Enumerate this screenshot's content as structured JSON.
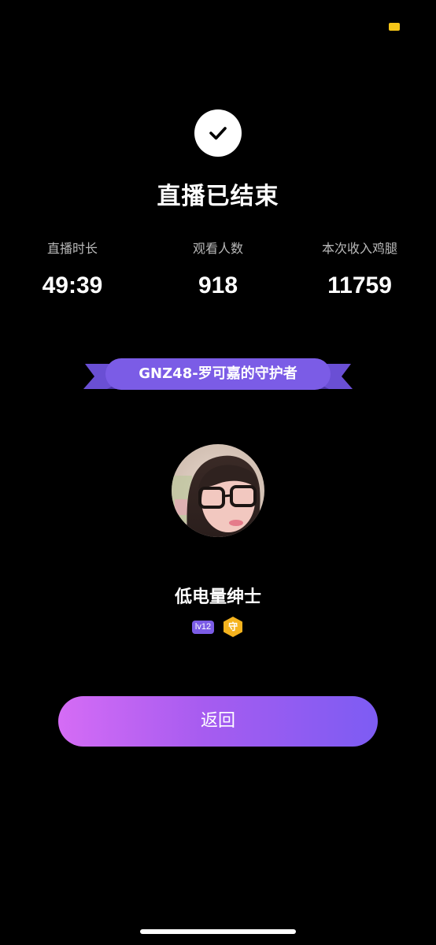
{
  "status_bar": {
    "indicator_color": "#f5c518"
  },
  "header": {
    "status_icon": "check-icon",
    "title": "直播已结束"
  },
  "stats": [
    {
      "label": "直播时长",
      "value": "49:39"
    },
    {
      "label": "观看人数",
      "value": "918"
    },
    {
      "label": "本次收入鸡腿",
      "value": "11759"
    }
  ],
  "guardian": {
    "ribbon_label": "GNZ48-罗可嘉的守护者",
    "ribbon_color": "#7b5ce6",
    "avatar": "user-avatar-photo",
    "username": "低电量绅士",
    "level_badge": "lv12",
    "guard_badge": "守",
    "guard_color": "#f5b31e"
  },
  "actions": {
    "back_label": "返回"
  },
  "colors": {
    "background": "#000000",
    "button_gradient_start": "#d56cf5",
    "button_gradient_end": "#7d5cf3"
  }
}
